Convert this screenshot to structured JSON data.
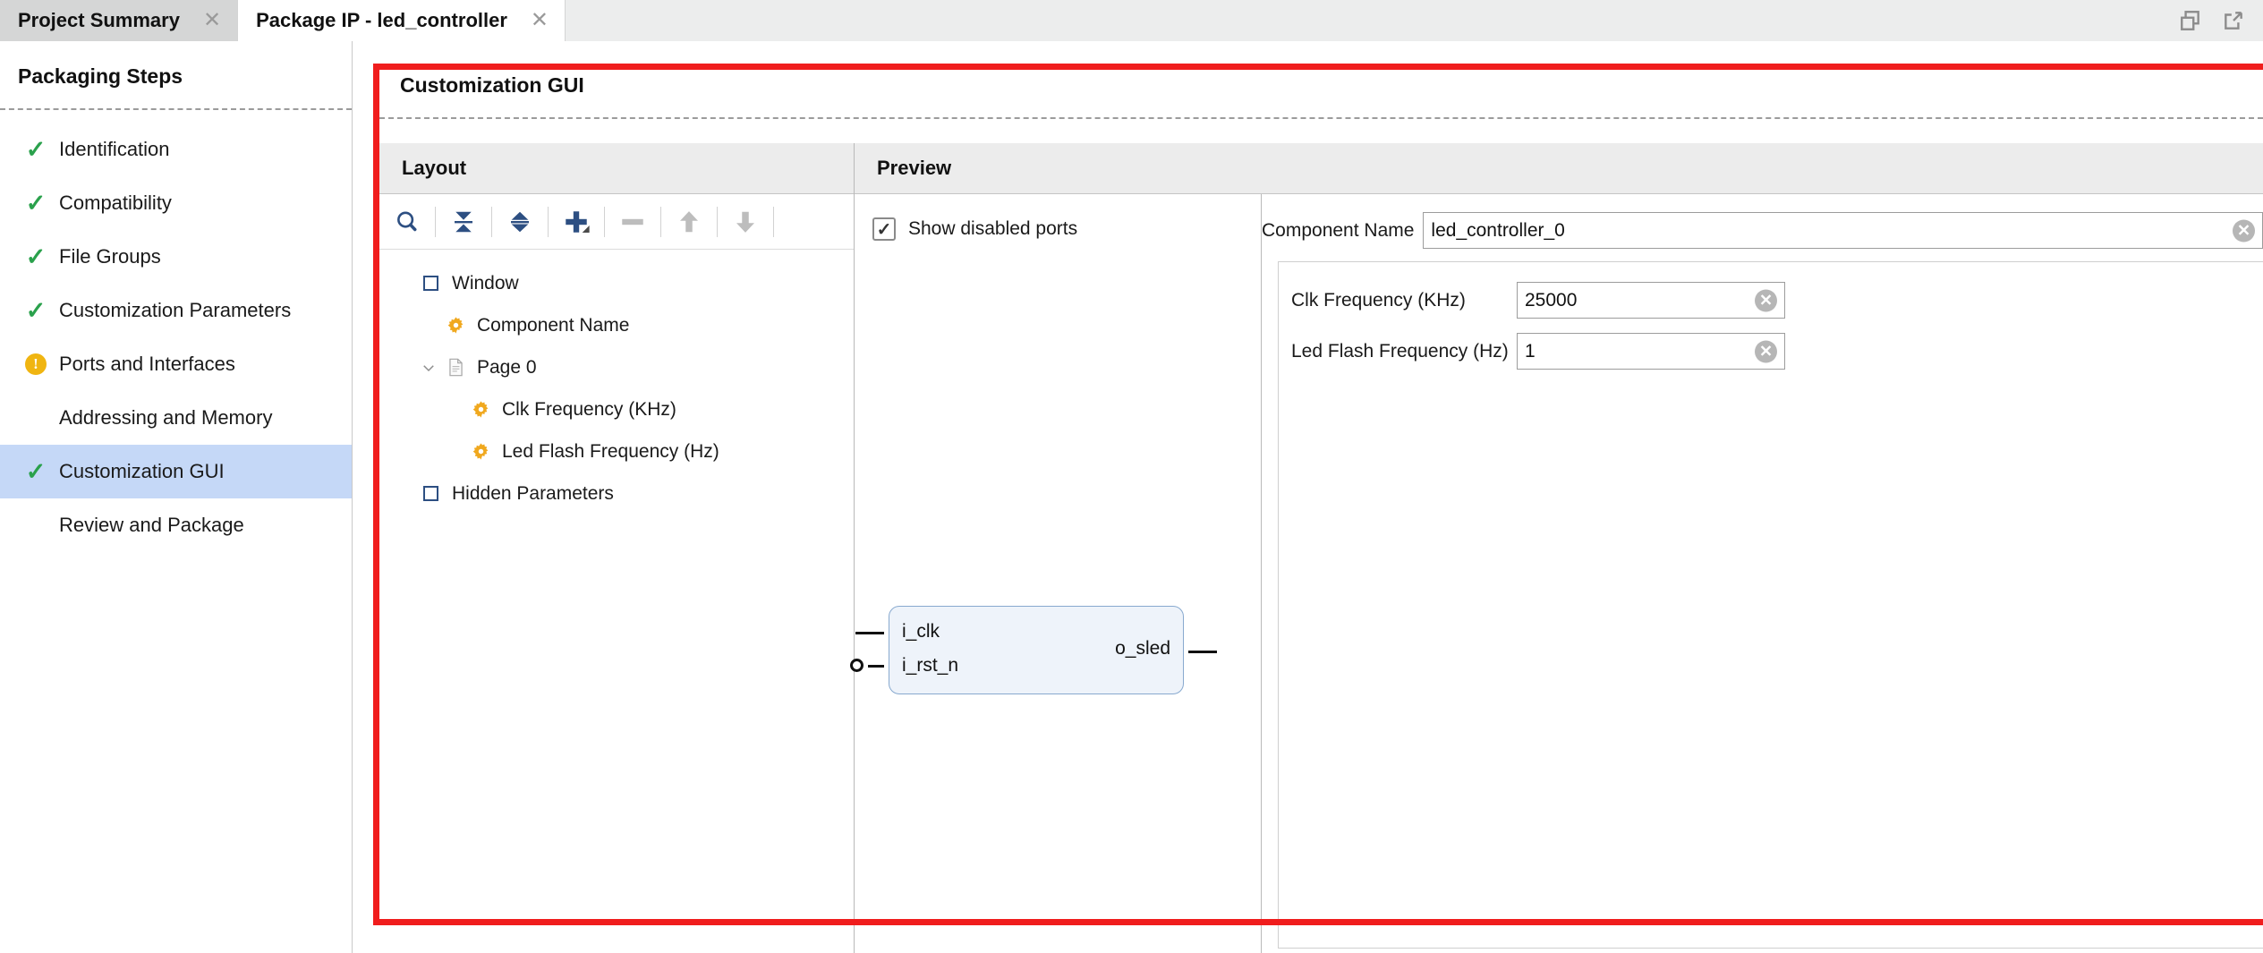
{
  "window": {
    "tabs": [
      {
        "label": "Project Summary",
        "active": false,
        "close_icon": "close-icon"
      },
      {
        "label": "Package IP - led_controller",
        "active": true,
        "close_icon": "close-icon"
      }
    ],
    "controls": [
      {
        "name": "restore-window-icon"
      },
      {
        "name": "float-window-icon"
      }
    ]
  },
  "sidebar": {
    "title": "Packaging Steps",
    "items": [
      {
        "label": "Identification",
        "status": "complete",
        "selected": false
      },
      {
        "label": "Compatibility",
        "status": "complete",
        "selected": false
      },
      {
        "label": "File Groups",
        "status": "complete",
        "selected": false
      },
      {
        "label": "Customization Parameters",
        "status": "complete",
        "selected": false
      },
      {
        "label": "Ports and Interfaces",
        "status": "warning",
        "selected": false
      },
      {
        "label": "Addressing and Memory",
        "status": "none",
        "selected": false
      },
      {
        "label": "Customization GUI",
        "status": "complete",
        "selected": true
      },
      {
        "label": "Review and Package",
        "status": "none",
        "selected": false
      }
    ]
  },
  "main": {
    "title": "Customization GUI"
  },
  "layout_panel": {
    "header": "Layout",
    "toolbar": [
      {
        "name": "search-icon",
        "enabled": true
      },
      {
        "name": "collapse-all-icon",
        "enabled": true
      },
      {
        "name": "expand-all-icon",
        "enabled": true
      },
      {
        "name": "add-icon",
        "enabled": true
      },
      {
        "name": "remove-icon",
        "enabled": false
      },
      {
        "name": "move-up-icon",
        "enabled": false
      },
      {
        "name": "move-down-icon",
        "enabled": false
      }
    ],
    "tree": [
      {
        "label": "Window",
        "icon": "window-icon",
        "indent": 0,
        "twisty": ""
      },
      {
        "label": "Component Name",
        "icon": "gear-icon",
        "indent": 1,
        "twisty": ""
      },
      {
        "label": "Page 0",
        "icon": "page-icon",
        "indent": 1,
        "twisty": "expanded"
      },
      {
        "label": "Clk Frequency (KHz)",
        "icon": "gear-icon",
        "indent": 2,
        "twisty": ""
      },
      {
        "label": "Led Flash Frequency (Hz)",
        "icon": "gear-icon",
        "indent": 2,
        "twisty": ""
      },
      {
        "label": "Hidden Parameters",
        "icon": "window-icon",
        "indent": 0,
        "twisty": ""
      }
    ]
  },
  "preview_panel": {
    "header": "Preview",
    "show_disabled_ports": {
      "label": "Show disabled ports",
      "checked": true
    },
    "block_diagram": {
      "inputs": [
        {
          "name": "i_clk",
          "inverted": false
        },
        {
          "name": "i_rst_n",
          "inverted": true
        }
      ],
      "outputs": [
        {
          "name": "o_sled"
        }
      ]
    },
    "component_name": {
      "label": "Component Name",
      "value": "led_controller_0",
      "clear_icon": "clear-icon"
    },
    "parameters": [
      {
        "label": "Clk Frequency (KHz)",
        "value": "25000",
        "clear_icon": "clear-icon"
      },
      {
        "label": "Led Flash Frequency (Hz)",
        "value": "1",
        "clear_icon": "clear-icon"
      }
    ]
  },
  "annotation": {
    "highlight_color": "#f01d1d"
  },
  "colors": {
    "accent_blue": "#2d4f82",
    "gear_orange": "#f0a81e",
    "check_green": "#2aa14c",
    "warn_amber": "#f0b511",
    "selection_blue": "#c5d8f7"
  }
}
